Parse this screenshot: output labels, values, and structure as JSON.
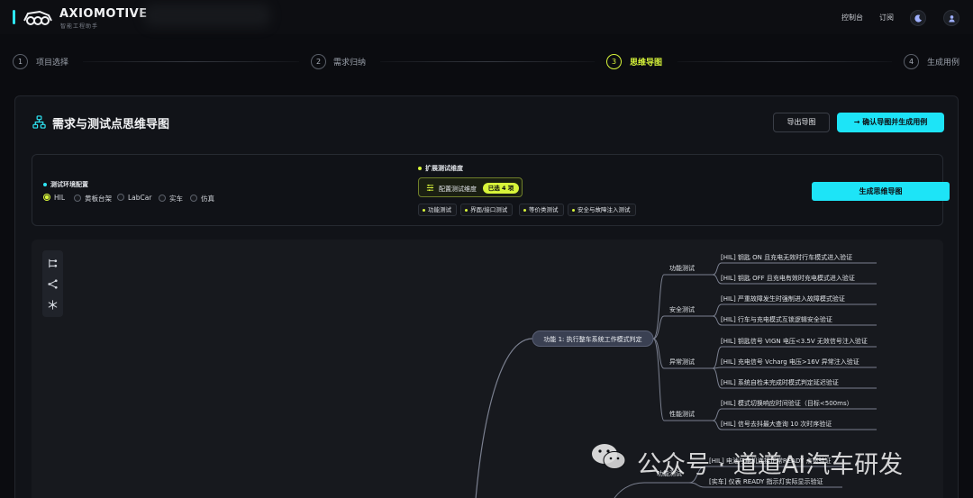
{
  "header": {
    "brand": "AXIOMOTIVE",
    "brand_sub": "智能工程助手",
    "nav": [
      "控制台",
      "订阅"
    ],
    "theme_icon": "moon-icon",
    "user_icon": "user-icon",
    "accent": "#2ee6f5"
  },
  "stepper": {
    "steps": [
      {
        "num": "1",
        "label": "项目选择",
        "active": false
      },
      {
        "num": "2",
        "label": "需求归纳",
        "active": false
      },
      {
        "num": "3",
        "label": "思维导图",
        "active": true
      },
      {
        "num": "4",
        "label": "生成用例",
        "active": false
      }
    ],
    "active_color": "#d8f53a"
  },
  "card": {
    "title": "需求与测试点思维导图",
    "export_label": "导出导图",
    "confirm_label": "确认导图并生成用例"
  },
  "config": {
    "env_title": "测试环境配置",
    "env_options": [
      {
        "label": "HIL",
        "selected": true
      },
      {
        "label": "黄板台架",
        "selected": false
      },
      {
        "label": "LabCar",
        "selected": false
      },
      {
        "label": "实车",
        "selected": false
      },
      {
        "label": "仿真",
        "selected": false
      }
    ],
    "ext_title": "扩展测试维度",
    "dim_button": "配置测试维度",
    "dim_badge": "已选 4 项",
    "chips": [
      "功能测试",
      "界面/接口测试",
      "等价类测试",
      "安全与故障注入测试"
    ],
    "generate_label": "生成思维导图"
  },
  "mindmap": {
    "root": "功能 1: 执行整车系统工作模式判定",
    "branches": [
      {
        "name": "功能测试",
        "leaves": [
          "[HIL] 钥匙 ON 且充电无效时行车模式进入验证",
          "[HIL] 钥匙 OFF 且充电有效时充电模式进入验证"
        ]
      },
      {
        "name": "安全测试",
        "leaves": [
          "[HIL] 严重故障发生时强制进入故障模式验证",
          "[HIL] 行车与充电模式互锁逻辑安全验证"
        ]
      },
      {
        "name": "异常测试",
        "leaves": [
          "[HIL] 钥匙信号 VIGN 电压<3.5V 无效信号注入验证",
          "[HIL] 充电信号 Vcharg 电压>16V 异常注入验证",
          "[HIL] 系统自检未完成时模式判定延迟验证"
        ]
      },
      {
        "name": "性能测试",
        "leaves": [
          "[HIL] 模式切换响应时间验证（目标<500ms）",
          "[HIL] 信号去抖最大查询 10 次时序验证"
        ]
      }
    ],
    "next_branch": {
      "name": "功能测试",
      "leaves": [
        "[HIL] 电池与电机连接正常READY 点亮验证",
        "[实车] 仪表 READY 指示灯实际显示验证"
      ]
    },
    "node_color": "#3a4052",
    "line_color": "#7b8090"
  },
  "toolbar_icons": [
    "layout-tree-icon",
    "branch-icon",
    "fan-layout-icon"
  ],
  "watermark": "公众号 · 道道AI汽车研发"
}
